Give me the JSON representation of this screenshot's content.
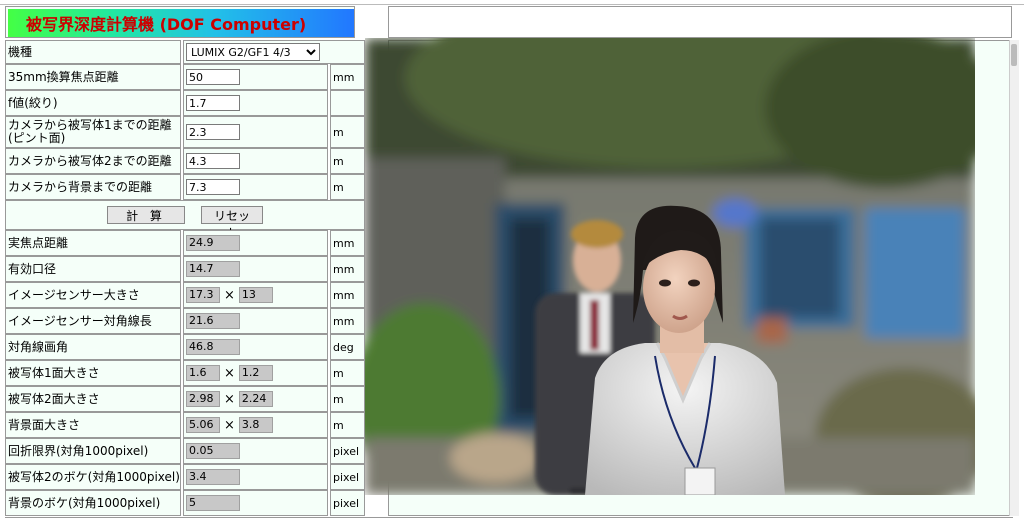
{
  "title": "被写界深度計算機 (DOF Computer)",
  "model": {
    "label": "機種",
    "selected": "LUMIX G2/GF1 4/3"
  },
  "inputs": [
    {
      "label": "35mm換算焦点距離",
      "value": "50",
      "unit": "mm"
    },
    {
      "label": "f値(絞り)",
      "value": "1.7",
      "unit": ""
    },
    {
      "label": "カメラから被写体1までの距離(ピント面)",
      "value": "2.3",
      "unit": "m"
    },
    {
      "label": "カメラから被写体2までの距離",
      "value": "4.3",
      "unit": "m"
    },
    {
      "label": "カメラから背景までの距離",
      "value": "7.3",
      "unit": "m"
    }
  ],
  "buttons": {
    "calculate": "計 算",
    "reset": "リセット"
  },
  "outputs": [
    {
      "label": "実焦点距離",
      "values": [
        "24.9"
      ],
      "unit": "mm"
    },
    {
      "label": "有効口径",
      "values": [
        "14.7"
      ],
      "unit": "mm"
    },
    {
      "label": "イメージセンサー大きさ",
      "values": [
        "17.3",
        "13"
      ],
      "unit": "mm"
    },
    {
      "label": "イメージセンサー対角線長",
      "values": [
        "21.6"
      ],
      "unit": "mm"
    },
    {
      "label": "対角線画角",
      "values": [
        "46.8"
      ],
      "unit": "deg"
    },
    {
      "label": "被写体1面大きさ",
      "values": [
        "1.6",
        "1.2"
      ],
      "unit": "m"
    },
    {
      "label": "被写体2面大きさ",
      "values": [
        "2.98",
        "2.24"
      ],
      "unit": "m"
    },
    {
      "label": "背景面大きさ",
      "values": [
        "5.06",
        "3.8"
      ],
      "unit": "m"
    },
    {
      "label": "回折限界(対角1000pixel)",
      "values": [
        "0.05"
      ],
      "unit": "pixel"
    },
    {
      "label": "被写体2のボケ(対角1000pixel)",
      "values": [
        "3.4"
      ],
      "unit": "pixel"
    },
    {
      "label": "背景のボケ(対角1000pixel)",
      "values": [
        "5"
      ],
      "unit": "pixel"
    }
  ],
  "times_symbol": "×"
}
